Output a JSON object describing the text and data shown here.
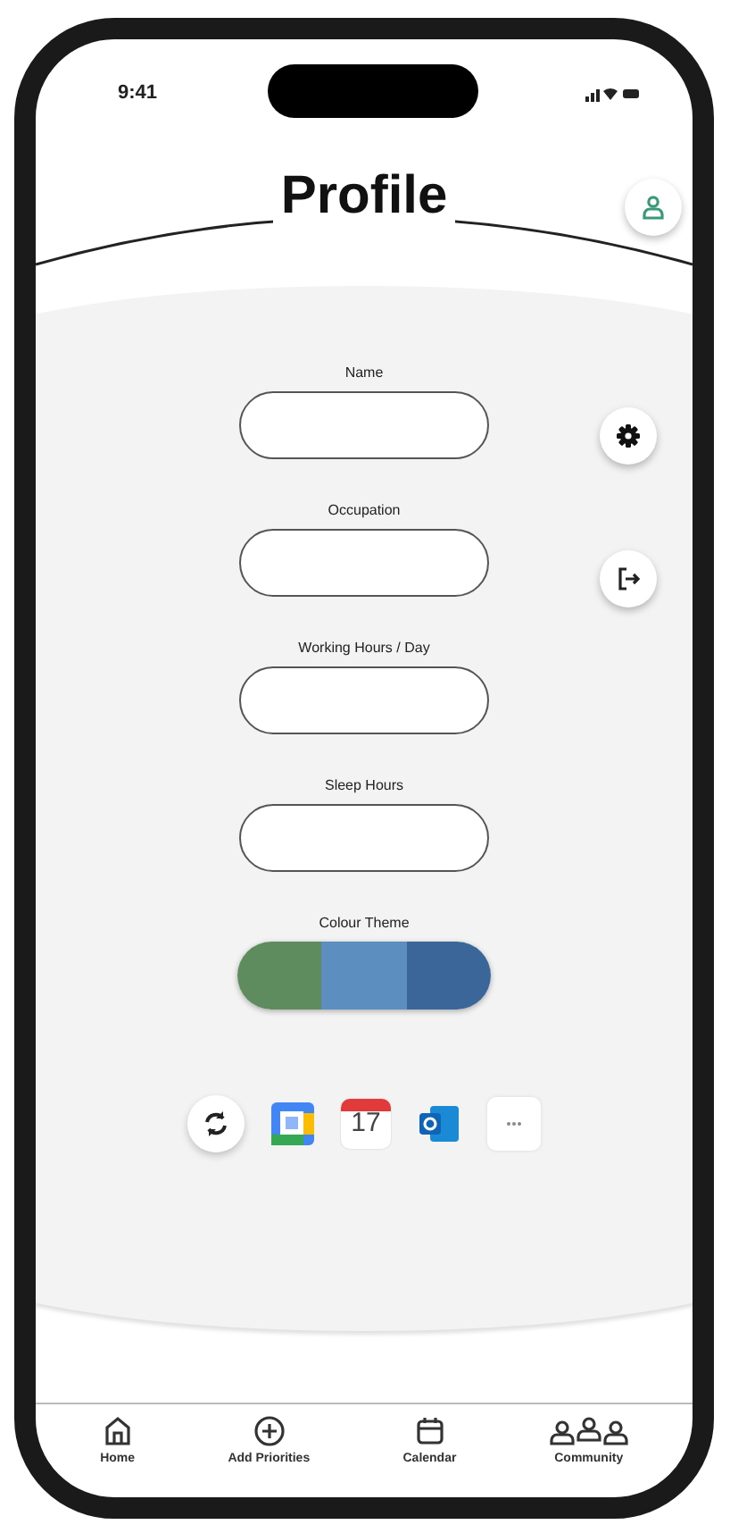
{
  "status_bar": {
    "time": "9:41"
  },
  "header": {
    "title": "Profile"
  },
  "form": {
    "fields": [
      {
        "label": "Name"
      },
      {
        "label": "Occupation"
      },
      {
        "label": "Working Hours / Day"
      },
      {
        "label": "Sleep Hours"
      }
    ],
    "colour_theme": {
      "label": "Colour Theme",
      "swatches": [
        {
          "color": "#5f8c5f"
        },
        {
          "color": "#5c8fbf"
        },
        {
          "color": "#3b6699"
        }
      ]
    }
  },
  "integrations": [
    {
      "kind": "sync"
    },
    {
      "kind": "google-calendar"
    },
    {
      "kind": "calendar",
      "day": "17"
    },
    {
      "kind": "outlook"
    },
    {
      "kind": "more"
    }
  ],
  "nav": [
    {
      "kind": "home",
      "label": "Home"
    },
    {
      "kind": "add",
      "label": "Add Priorities"
    },
    {
      "kind": "calendar",
      "label": "Calendar"
    },
    {
      "kind": "community",
      "label": "Community"
    }
  ]
}
